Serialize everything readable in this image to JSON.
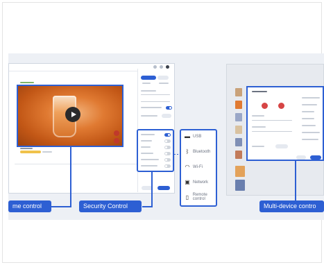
{
  "callouts": {
    "left": "me control",
    "middle": "Security Control",
    "right": "Multi-device contro"
  },
  "feature_icons": [
    {
      "icon": "usb-icon",
      "glyph": "▬",
      "label": "USB"
    },
    {
      "icon": "bluetooth-icon",
      "glyph": "ᛒ",
      "label": "Bluetooth"
    },
    {
      "icon": "wifi-icon",
      "glyph": "◠",
      "label": "Wi-Fi"
    },
    {
      "icon": "network-icon",
      "glyph": "▣",
      "label": "Network"
    },
    {
      "icon": "remote-control-icon",
      "glyph": "▯",
      "label": "Remote control"
    }
  ],
  "colors": {
    "accent": "#2d5fd3",
    "background_band": "#edf0f5",
    "video_orange": "#e07a32",
    "alert_red": "#c0392b"
  }
}
